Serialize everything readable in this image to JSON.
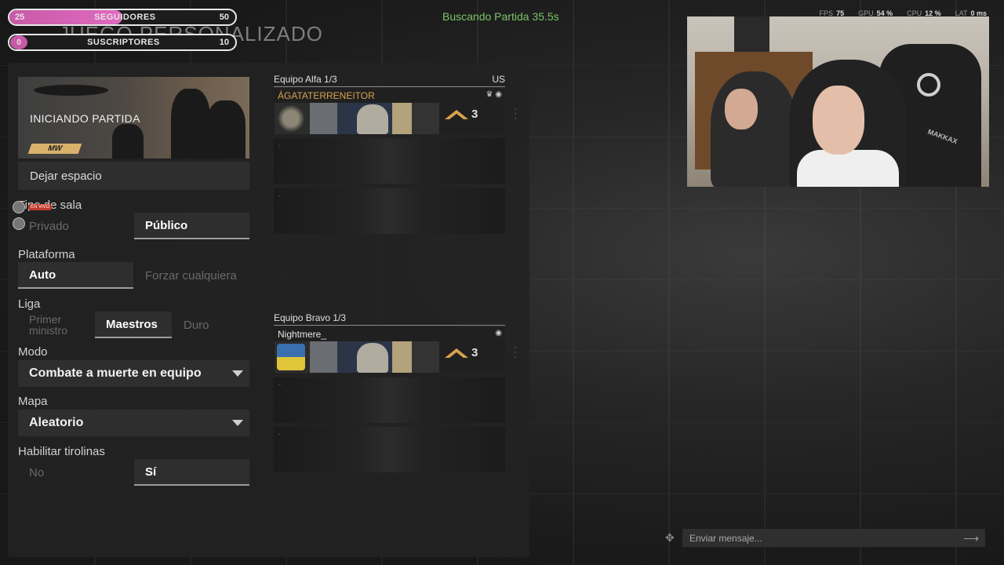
{
  "header": {
    "title": "JUEGO PERSONALIZADO",
    "searching": "Buscando Partida 35.5s",
    "stats": [
      {
        "label": "FPS",
        "value": "75"
      },
      {
        "label": "GPU",
        "value": "54 %"
      },
      {
        "label": "CPU",
        "value": "12 %"
      },
      {
        "label": "LAT",
        "value": "0 ms"
      }
    ]
  },
  "goals": {
    "followers": {
      "current": "25",
      "label": "SEGUIDORES",
      "target": "50",
      "progress": 0.5
    },
    "subscribers": {
      "current": "0",
      "label": "SUSCRIPTORES",
      "target": "10",
      "progress": 0
    }
  },
  "lobby": {
    "banner_title": "INICIANDO PARTIDA",
    "banner_logo": "MW",
    "leave_label": "Dejar espacio",
    "room_type": {
      "label": "Tipo de sala",
      "options": [
        "Privado",
        "Público"
      ],
      "selected": "Público"
    },
    "platform": {
      "label": "Plataforma",
      "options": [
        "Auto",
        "Forzar cualquiera"
      ],
      "selected": "Auto"
    },
    "league": {
      "label": "Liga",
      "options": [
        "Primer ministro",
        "Maestros",
        "Duro"
      ],
      "selected": "Maestros"
    },
    "mode": {
      "label": "Modo",
      "value": "Combate a muerte en equipo"
    },
    "map": {
      "label": "Mapa",
      "value": "Aleatorio"
    },
    "ziplines": {
      "label": "Habilitar tirolinas",
      "options": [
        "No",
        "Sí"
      ],
      "selected": "Sí"
    }
  },
  "chat_overlay": {
    "live_badge": "EN VIVO"
  },
  "teams": [
    {
      "name": "Equipo Alfa 1/3",
      "region": "US",
      "player": {
        "name": "ÁGATATERRENEITOR",
        "level": "3"
      },
      "empty_slots": [
        "-",
        "-"
      ]
    },
    {
      "name": "Equipo Bravo 1/3",
      "region": "",
      "player": {
        "name": "Nightmere_",
        "level": "3"
      },
      "empty_slots": [
        "-",
        "-"
      ]
    }
  ],
  "webcam": {
    "brand": "MAKKAX"
  },
  "chat": {
    "placeholder": "Enviar mensaje..."
  },
  "colors": {
    "accent_green": "#7cc36a",
    "gold": "#d6a24d",
    "goal_pink": "#c85aa8"
  }
}
